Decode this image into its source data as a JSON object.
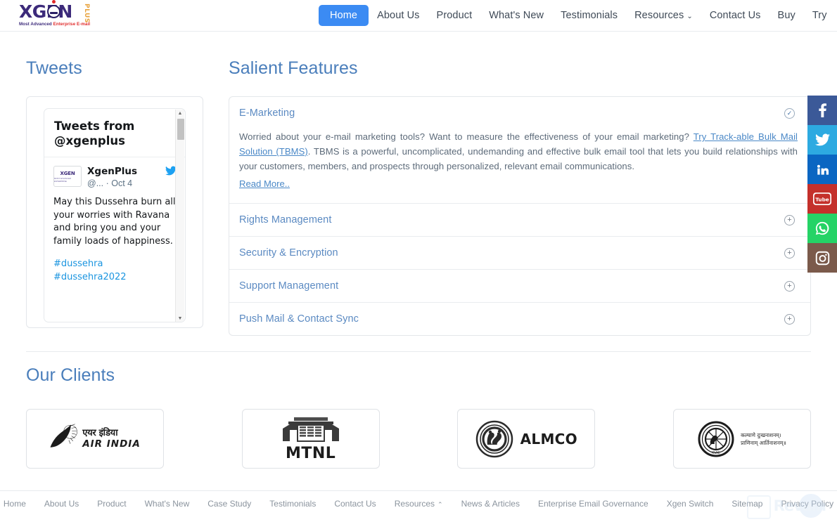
{
  "header": {
    "logo": {
      "word": "XGEN",
      "plus": "PLUS",
      "tagline_1": "Most Advanced ",
      "tagline_2": "Enterprise E-mail"
    },
    "nav": [
      {
        "label": "Home",
        "active": true,
        "caret": ""
      },
      {
        "label": "About Us",
        "active": false,
        "caret": ""
      },
      {
        "label": "Product",
        "active": false,
        "caret": ""
      },
      {
        "label": "What's New",
        "active": false,
        "caret": ""
      },
      {
        "label": "Testimonials",
        "active": false,
        "caret": ""
      },
      {
        "label": "Resources",
        "active": false,
        "caret": "⌄"
      },
      {
        "label": "Contact Us",
        "active": false,
        "caret": ""
      },
      {
        "label": "Buy",
        "active": false,
        "caret": ""
      },
      {
        "label": "Try",
        "active": false,
        "caret": ""
      }
    ]
  },
  "tweets": {
    "heading": "Tweets",
    "widget_title": "Tweets from @xgenplus",
    "avatar_word": "XGEN",
    "avatar_sub": "MOST ADVANCED ENTERPRISE",
    "user_name": "XgenPlus",
    "user_handle": "@... · Oct 4",
    "bird_icon": "twitter-bird-icon",
    "text": "May this Dussehra burn all your worries with Ravana and bring you and your family loads of happiness.",
    "hashtags": "#dussehra\n#dussehra2022"
  },
  "features": {
    "heading": "Salient Features",
    "items": [
      {
        "title": "E-Marketing",
        "expanded": true,
        "icon": "check-circle-icon",
        "body_before_link": "Worried about your e-mail marketing tools? Want to measure the effectiveness of your email marketing? ",
        "body_link": "Try Track-able Bulk Mail Solution (TBMS)",
        "body_after_link": ". TBMS is a powerful, uncomplicated, undemanding and effective bulk email tool that lets you build relationships with your customers, members, and prospects through personalized, relevant email communications.",
        "read_more": "Read More.."
      },
      {
        "title": "Rights Management",
        "expanded": false,
        "icon": "plus-circle-icon"
      },
      {
        "title": "Security & Encryption",
        "expanded": false,
        "icon": "plus-circle-icon"
      },
      {
        "title": "Support Management",
        "expanded": false,
        "icon": "plus-circle-icon"
      },
      {
        "title": "Push Mail & Contact Sync",
        "expanded": false,
        "icon": "plus-circle-icon"
      }
    ]
  },
  "clients": {
    "heading": "Our Clients",
    "logos": [
      {
        "name": "air-india",
        "hindi": "एयर इंडिया",
        "english": "AIR INDIA"
      },
      {
        "name": "mtnl",
        "english": "MTNL"
      },
      {
        "name": "almco",
        "english": "ALMCO"
      },
      {
        "name": "kvic",
        "sanskrit_line1": "कल्याणे दुःखनाशनम्।",
        "sanskrit_line2": "प्राणिनाम् आर्तिनाशनम्॥",
        "mark": "KVIC"
      }
    ]
  },
  "social": [
    {
      "name": "facebook",
      "glyph": "f",
      "color": "#3b5998"
    },
    {
      "name": "twitter",
      "glyph": "",
      "color": "#2daae1"
    },
    {
      "name": "linkedin",
      "glyph": "in",
      "color": "#0a66c2"
    },
    {
      "name": "youtube",
      "glyph": "Tube",
      "color": "#c4302b"
    },
    {
      "name": "whatsapp",
      "glyph": "",
      "color": "#25d366"
    },
    {
      "name": "instagram",
      "glyph": "",
      "color": "#7b5a4b"
    }
  ],
  "footer": {
    "nav": [
      {
        "label": "Home",
        "caret": ""
      },
      {
        "label": "About Us",
        "caret": ""
      },
      {
        "label": "Product",
        "caret": ""
      },
      {
        "label": "What's New",
        "caret": ""
      },
      {
        "label": "Case Study",
        "caret": ""
      },
      {
        "label": "Testimonials",
        "caret": ""
      },
      {
        "label": "Contact Us",
        "caret": ""
      },
      {
        "label": "Resources",
        "caret": "⌃"
      },
      {
        "label": "News & Articles",
        "caret": ""
      },
      {
        "label": "Enterprise Email Governance",
        "caret": ""
      },
      {
        "label": "Xgen Switch",
        "caret": ""
      },
      {
        "label": "Sitemap",
        "caret": ""
      },
      {
        "label": "Privacy Policy",
        "caret": ""
      }
    ]
  },
  "watermark": {
    "text": "Revain"
  },
  "colors": {
    "accent_blue": "#3b8bf3",
    "heading_blue": "#4a7ebb",
    "link_blue": "#4a88c7",
    "body_gray": "#5d6b7a"
  }
}
